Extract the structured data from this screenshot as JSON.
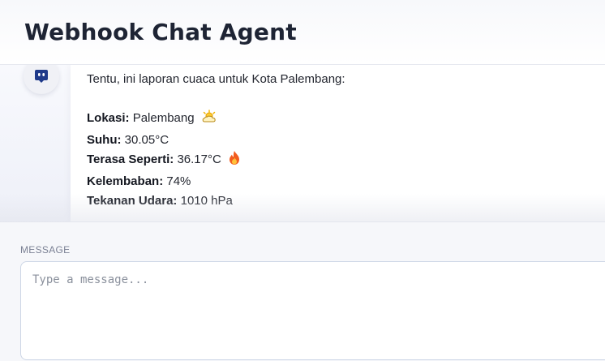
{
  "header": {
    "title": "Webhook Chat Agent"
  },
  "chat": {
    "message": {
      "intro": "Tentu, ini laporan cuaca untuk Kota Palembang:",
      "fields": [
        {
          "key": "Lokasi:",
          "value": "Palembang",
          "emoji": "sun-behind-cloud-icon"
        },
        {
          "key": "Suhu:",
          "value": "30.05°C"
        },
        {
          "key": "Terasa Seperti:",
          "value": "36.17°C",
          "emoji": "fire-icon"
        },
        {
          "key": "Kelembaban:",
          "value": "74%"
        },
        {
          "key": "Tekanan Udara:",
          "value": "1010 hPa"
        }
      ]
    },
    "avatar_icon": "robot-icon"
  },
  "composer": {
    "label": "MESSAGE",
    "placeholder": "Type a message..."
  },
  "colors": {
    "accent": "#1f3a8a",
    "text": "#23262f",
    "input_border": "#cdd6e6"
  }
}
